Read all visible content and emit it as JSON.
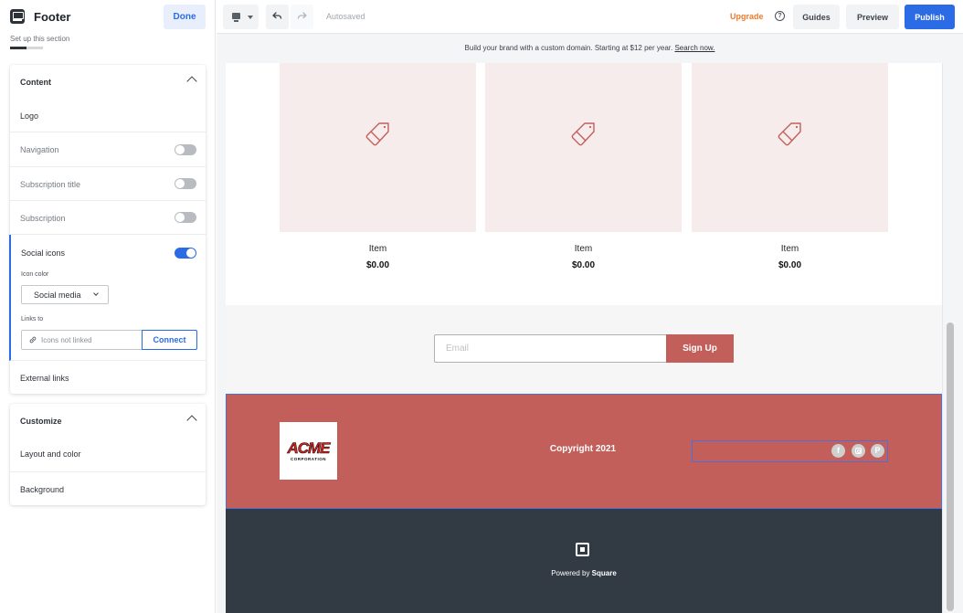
{
  "panel": {
    "title": "Footer",
    "subtitle": "Set up this section",
    "setup_progress": 0.5,
    "done_label": "Done",
    "content_card": {
      "heading": "Content",
      "rows": [
        {
          "label": "Logo",
          "toggle": null
        },
        {
          "label": "Navigation",
          "toggle": false
        },
        {
          "label": "Subscription title",
          "toggle": false
        },
        {
          "label": "Subscription",
          "toggle": false
        },
        {
          "label": "Social icons",
          "toggle": true
        },
        {
          "label": "External links",
          "toggle": null
        }
      ],
      "social": {
        "icon_color_label": "Icon color",
        "icon_color_value": "Social media",
        "links_to_label": "Links to",
        "links_placeholder": "Icons not linked",
        "connect_label": "Connect"
      }
    },
    "customize_card": {
      "heading": "Customize",
      "rows": [
        {
          "label": "Layout and color"
        },
        {
          "label": "Background"
        }
      ]
    }
  },
  "topbar": {
    "autosaved": "Autosaved",
    "upgrade": "Upgrade",
    "help_glyph": "?",
    "guides": "Guides",
    "preview": "Preview",
    "publish": "Publish"
  },
  "banner": {
    "text": "Build your brand with a custom domain. Starting at $12 per year. ",
    "link": "Search now."
  },
  "site": {
    "items": [
      {
        "name": "Item",
        "price": "$0.00"
      },
      {
        "name": "Item",
        "price": "$0.00"
      },
      {
        "name": "Item",
        "price": "$0.00"
      }
    ],
    "email_placeholder": "Email",
    "signup_label": "Sign Up",
    "logo_text": "ACME",
    "logo_subtext": "CORPORATION",
    "copyright": "Copyright 2021",
    "social_icons": [
      "facebook",
      "instagram",
      "pinterest"
    ],
    "social_glyphs": {
      "facebook": "f",
      "pinterest": "P"
    },
    "powered_by": "Powered by ",
    "powered_brand": "Square"
  },
  "colors": {
    "accent": "#2b6be6",
    "brand": "#c25f5a",
    "upgrade": "#f07a2b",
    "footer_dark": "#323a44"
  }
}
